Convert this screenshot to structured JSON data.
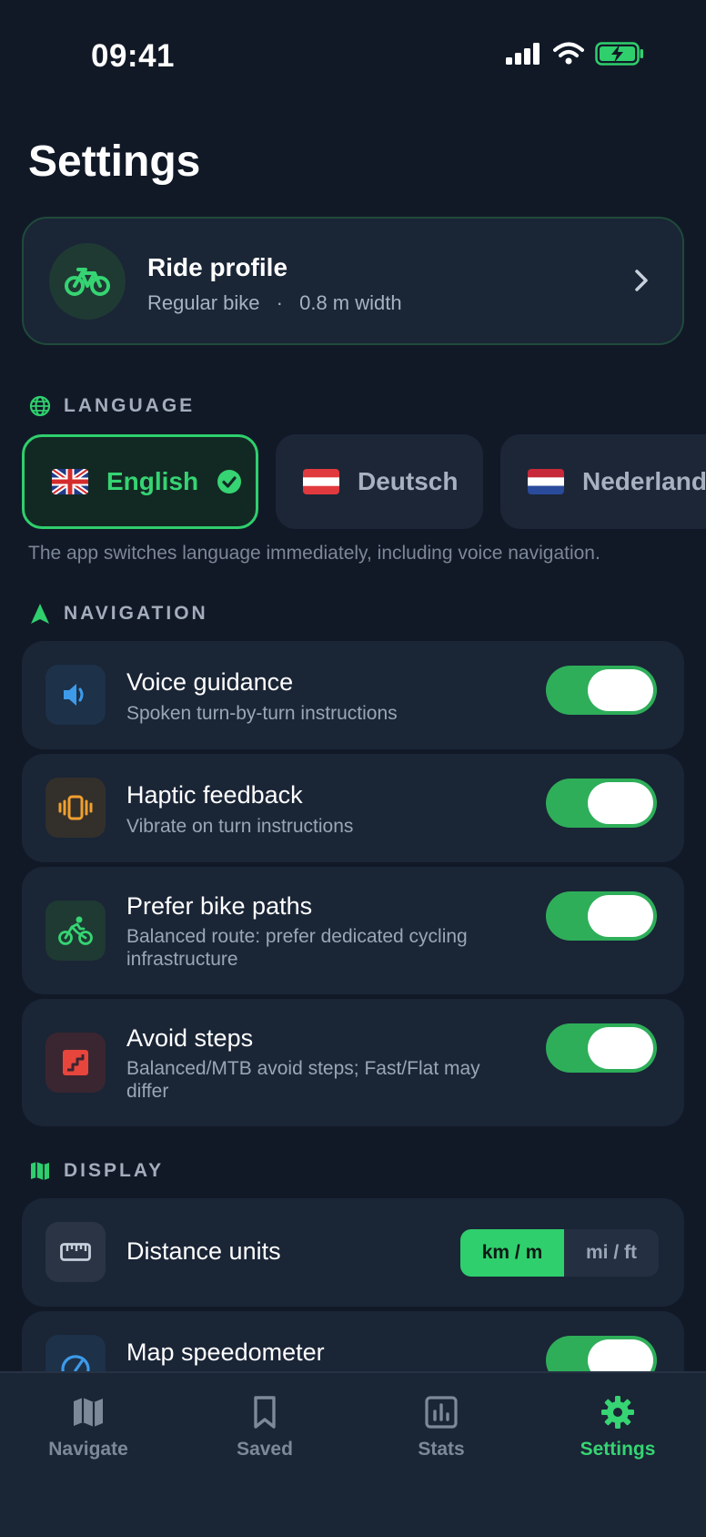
{
  "status": {
    "time": "09:41"
  },
  "page": {
    "title": "Settings"
  },
  "profile": {
    "title": "Ride profile",
    "bike": "Regular bike",
    "separator": "·",
    "width": "0.8 m width"
  },
  "sections": {
    "language": "LANGUAGE",
    "navigation": "NAVIGATION",
    "display": "DISPLAY"
  },
  "languages": [
    {
      "name": "English",
      "selected": true
    },
    {
      "name": "Deutsch",
      "selected": false
    },
    {
      "name": "Nederlands",
      "selected": false
    }
  ],
  "language_note": "The app switches language immediately, including voice navigation.",
  "navigation": {
    "voice": {
      "title": "Voice guidance",
      "desc": "Spoken turn-by-turn instructions",
      "enabled": true
    },
    "haptic": {
      "title": "Haptic feedback",
      "desc": "Vibrate on turn instructions",
      "enabled": true
    },
    "bikepaths": {
      "title": "Prefer bike paths",
      "desc": "Balanced route: prefer dedicated cycling infrastructure",
      "enabled": true
    },
    "steps": {
      "title": "Avoid steps",
      "desc": "Balanced/MTB avoid steps; Fast/Flat may differ",
      "enabled": true
    }
  },
  "display": {
    "units": {
      "title": "Distance units",
      "options": [
        "km / m",
        "mi / ft"
      ],
      "selected": "km / m"
    },
    "speedometer": {
      "title": "Map speedometer",
      "enabled": true
    }
  },
  "tabs": [
    {
      "label": "Navigate",
      "icon": "map-icon",
      "active": false
    },
    {
      "label": "Saved",
      "icon": "bookmark-icon",
      "active": false
    },
    {
      "label": "Stats",
      "icon": "chart-icon",
      "active": false
    },
    {
      "label": "Settings",
      "icon": "gear-icon",
      "active": true
    }
  ],
  "colors": {
    "background": "#111927",
    "card": "#1a2536",
    "accent": "#2fcf6d",
    "toggle_on": "#2eae59"
  }
}
